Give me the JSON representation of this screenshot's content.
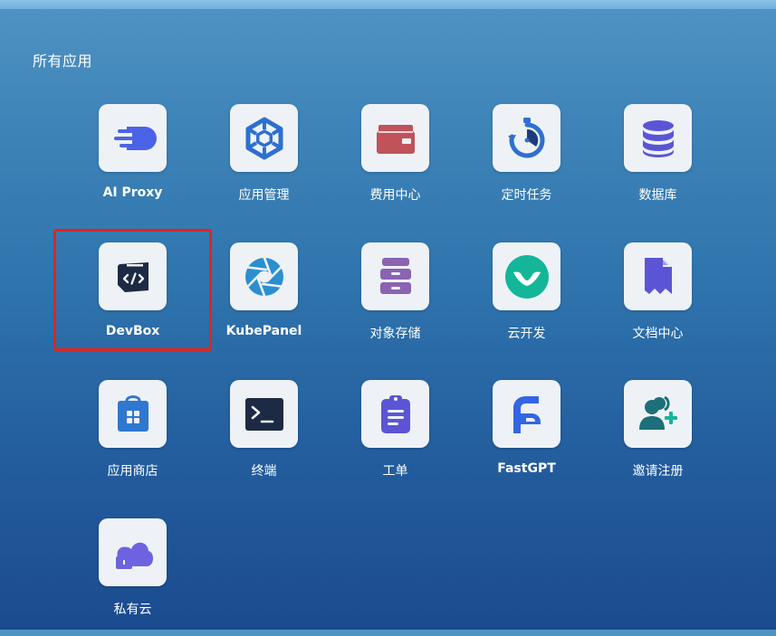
{
  "section": {
    "title": "所有应用"
  },
  "apps": [
    {
      "label": "AI Proxy",
      "icon": "ai-proxy-icon"
    },
    {
      "label": "应用管理",
      "icon": "app-manage-icon"
    },
    {
      "label": "费用中心",
      "icon": "wallet-icon"
    },
    {
      "label": "定时任务",
      "icon": "timer-icon"
    },
    {
      "label": "数据库",
      "icon": "database-icon"
    },
    {
      "label": "DevBox",
      "icon": "devbox-icon"
    },
    {
      "label": "KubePanel",
      "icon": "aperture-icon"
    },
    {
      "label": "对象存储",
      "icon": "storage-drawer-icon"
    },
    {
      "label": "云开发",
      "icon": "cloud-dev-icon"
    },
    {
      "label": "文档中心",
      "icon": "bookmark-doc-icon"
    },
    {
      "label": "应用商店",
      "icon": "shopping-bag-icon"
    },
    {
      "label": "终端",
      "icon": "terminal-icon"
    },
    {
      "label": "工单",
      "icon": "clipboard-icon"
    },
    {
      "label": "FastGPT",
      "icon": "fastgpt-icon"
    },
    {
      "label": "邀请注册",
      "icon": "add-user-icon"
    },
    {
      "label": "私有云",
      "icon": "private-cloud-icon"
    }
  ],
  "colors": {
    "highlight": "#e3241b",
    "tile_background": "#eef2f6"
  }
}
